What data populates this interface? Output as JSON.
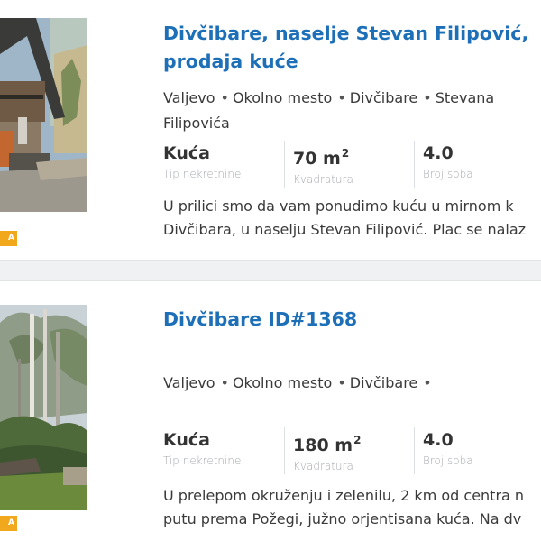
{
  "listings": [
    {
      "title_line1": "Divčibare, naselje Stevan Filipović,",
      "title_line2": "prodaja kuće",
      "location_line1": [
        "Valjevo",
        "Okolno mesto",
        "Divčibare",
        "Stevana"
      ],
      "location_line2": "Filipovića",
      "facts": [
        {
          "value": "Kuća",
          "label": "Tip nekretnine"
        },
        {
          "value": "70 m",
          "sup": "2",
          "label": "Kvadratura"
        },
        {
          "value": "4.0",
          "label": "Broj soba"
        }
      ],
      "desc_line1": "U prilici smo da vam ponudimo kuću u mirnom k",
      "desc_line2": "Divčibara, u naselju Stevan Filipović. Plac se nalaz",
      "badge": "A"
    },
    {
      "title_line1": "Divčibare ID#1368",
      "location_line1": [
        "Valjevo",
        "Okolno mesto",
        "Divčibare",
        ""
      ],
      "facts": [
        {
          "value": "Kuća",
          "label": "Tip nekretnine"
        },
        {
          "value": "180 m",
          "sup": "2",
          "label": "Kvadratura"
        },
        {
          "value": "4.0",
          "label": "Broj soba"
        }
      ],
      "desc_line1": "U prelepom okruženju i zelenilu, 2 km od centra n",
      "desc_line2": "putu prema Požegi, južno orjentisana kuća. Na dv",
      "badge": "A"
    }
  ],
  "colors": {
    "title": "#1d6fb8",
    "badge": "#f2a81d",
    "label": "#a5a9ae"
  },
  "images": [
    "house-photo",
    "forest-photo"
  ]
}
